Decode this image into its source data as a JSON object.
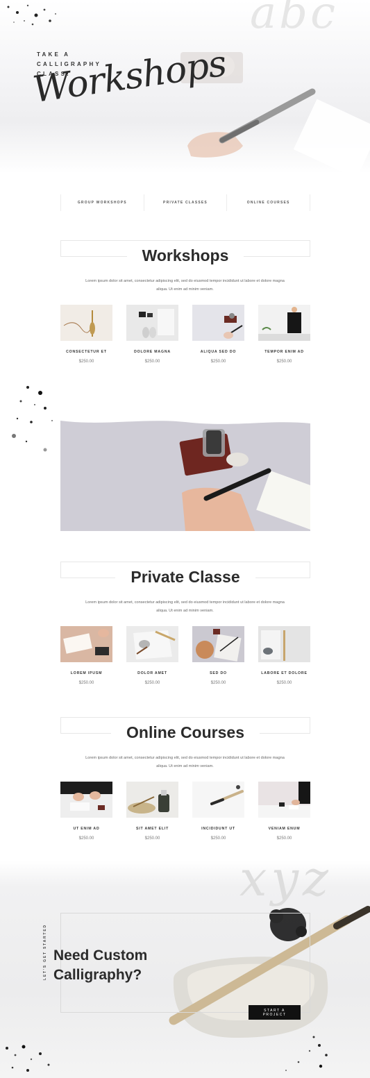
{
  "hero": {
    "bg_letters": "abc",
    "kicker": "TAKE A CALLIGRAPHY CLASS!",
    "script_title": "Workshops"
  },
  "tabs": [
    {
      "label": "GROUP WORKSHOPS"
    },
    {
      "label": "PRIVATE CLASSES"
    },
    {
      "label": "ONLINE COURSES"
    }
  ],
  "sections": [
    {
      "title": "Workshops",
      "description": "Lorem ipsum dolor sit amet, consectetur adipiscing elit, sed do eiusmod tempor incididunt ut labore et dolore magna aliqua. Ut enim ad minim veniam.",
      "items": [
        {
          "name": "CONSECTETUR ET",
          "price": "$250.00"
        },
        {
          "name": "DOLORE MAGNA",
          "price": "$250.00"
        },
        {
          "name": "ALIQUA SED DO",
          "price": "$250.00"
        },
        {
          "name": "TEMPOR ENIM AD",
          "price": "$250.00"
        }
      ]
    },
    {
      "title": "Private Classe",
      "description": "Lorem ipsum dolor sit amet, consectetur adipiscing elit, sed do eiusmod tempor incididunt ut labore et dolore magna aliqua. Ut enim ad minim veniam.",
      "items": [
        {
          "name": "LOREM IPUSM",
          "price": "$250.00"
        },
        {
          "name": "DOLOR AMET",
          "price": "$250.00"
        },
        {
          "name": "SED DO",
          "price": "$250.00"
        },
        {
          "name": "LABORE ET DOLORE",
          "price": "$250.00"
        }
      ]
    },
    {
      "title": "Online Courses",
      "description": "Lorem ipsum dolor sit amet, consectetur adipiscing elit, sed do eiusmod tempor incididunt ut labore et dolore magna aliqua. Ut enim ad minim veniam.",
      "items": [
        {
          "name": "UT ENIM AD",
          "price": "$250.00"
        },
        {
          "name": "SIT AMET ELIT",
          "price": "$250.00"
        },
        {
          "name": "INCIDIDUNT UT",
          "price": "$250.00"
        },
        {
          "name": "VENIAM ENUM",
          "price": "$250.00"
        }
      ]
    }
  ],
  "cta": {
    "bg_letters": "xyz",
    "vertical_label": "LET'S GET STARTED",
    "title_line1": "Need Custom",
    "title_line2": "Calligraphy?",
    "button_label": "START A PROJECT"
  }
}
